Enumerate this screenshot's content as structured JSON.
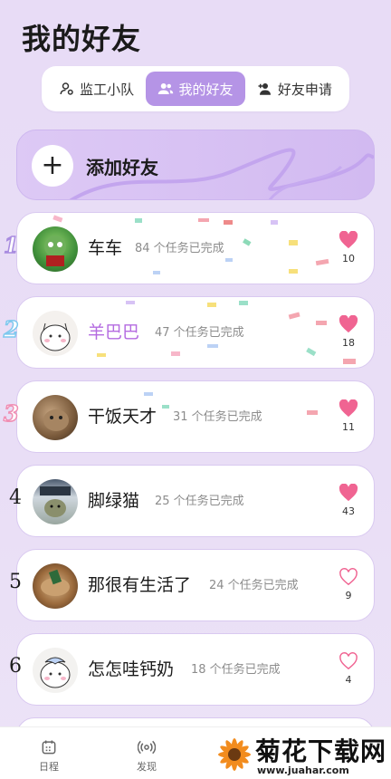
{
  "header": {
    "title": "我的好友"
  },
  "tabs": [
    {
      "label": "监工小队",
      "icon": "user-gear-icon",
      "active": false
    },
    {
      "label": "我的好友",
      "icon": "users-icon",
      "active": true
    },
    {
      "label": "好友申请",
      "icon": "user-plus-icon",
      "active": false
    }
  ],
  "add_friend": {
    "label": "添加好友",
    "icon": "plus-icon"
  },
  "friends": [
    {
      "rank": "1",
      "name": "车车",
      "tasks": "84 个任务已完成",
      "likes": "10",
      "liked": true,
      "name_color": "#1a1a1a"
    },
    {
      "rank": "2",
      "name": "羊巴巴",
      "tasks": "47 个任务已完成",
      "likes": "18",
      "liked": true,
      "name_color": "#b46be0"
    },
    {
      "rank": "3",
      "name": "干饭天才",
      "tasks": "31 个任务已完成",
      "likes": "11",
      "liked": true,
      "name_color": "#1a1a1a"
    },
    {
      "rank": "4",
      "name": "脚绿猫",
      "tasks": "25 个任务已完成",
      "likes": "43",
      "liked": true,
      "name_color": "#1a1a1a"
    },
    {
      "rank": "5",
      "name": "那很有生活了",
      "tasks": "24 个任务已完成",
      "likes": "9",
      "liked": false,
      "name_color": "#1a1a1a"
    },
    {
      "rank": "6",
      "name": "怎怎哇钙奶",
      "tasks": "18 个任务已完成",
      "likes": "4",
      "liked": false,
      "name_color": "#1a1a1a"
    }
  ],
  "bottom_nav": [
    {
      "label": "日程",
      "icon": "calendar-icon"
    },
    {
      "label": "发现",
      "icon": "broadcast-icon"
    }
  ],
  "watermark": {
    "title": "菊花下载网",
    "url": "www.juahar.com"
  },
  "colors": {
    "accent": "#b594e6",
    "heart": "#f06492",
    "heart_outline": "#f06492"
  }
}
